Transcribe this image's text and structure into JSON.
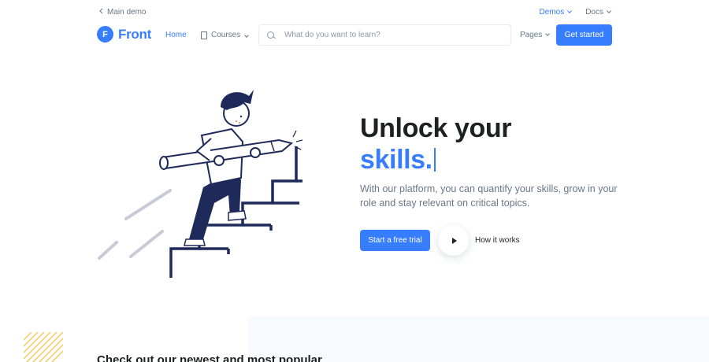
{
  "topbar": {
    "back_label": "Main demo",
    "demos_label": "Demos",
    "docs_label": "Docs"
  },
  "nav": {
    "logo_letter": "F",
    "logo_text": "Front",
    "home_label": "Home",
    "courses_label": "Courses",
    "search_placeholder": "What do you want to learn?",
    "pages_label": "Pages",
    "get_started_label": "Get started"
  },
  "hero": {
    "title_line1": "Unlock your",
    "title_line2": "skills.",
    "subtitle": "With our platform, you can quantify your skills, grow in your role and stay relevant on critical topics.",
    "trial_label": "Start a free trial",
    "how_it_works_label": "How it works"
  },
  "section": {
    "heading": "Check out our newest and most popular"
  },
  "colors": {
    "primary": "#377dff",
    "dark": "#1e2022",
    "muted": "#677788",
    "highlight": "#fbe2c9",
    "illustration_navy": "#1e2a5a",
    "stripes": "#f5ca5c"
  },
  "icons": {
    "back": "chevron-left-icon",
    "dropdown": "chevron-down-icon",
    "courses": "book-icon",
    "search": "search-icon",
    "play": "play-icon"
  }
}
